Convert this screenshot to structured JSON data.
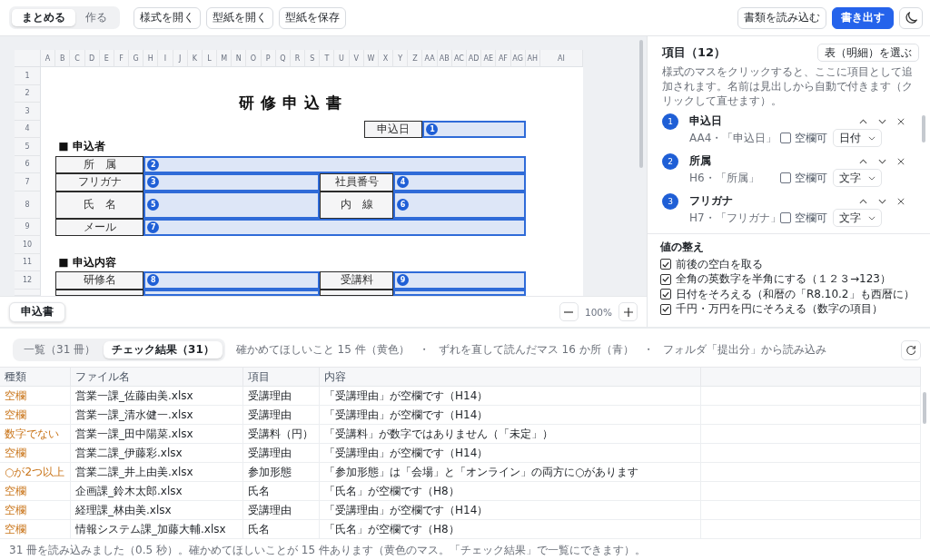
{
  "toolbar": {
    "modes": [
      {
        "label": "まとめる",
        "selected": true
      },
      {
        "label": "作る",
        "selected": false
      }
    ],
    "buttons": [
      "様式を開く",
      "型紙を開く",
      "型紙を保存"
    ],
    "actions": [
      {
        "label": "書類を読み込む",
        "kind": "secondary"
      },
      {
        "label": "書き出す",
        "kind": "primary"
      }
    ]
  },
  "sheet": {
    "columns": [
      "A",
      "B",
      "C",
      "D",
      "E",
      "F",
      "G",
      "H",
      "I",
      "J",
      "K",
      "L",
      "M",
      "N",
      "O",
      "P",
      "Q",
      "R",
      "S",
      "T",
      "U",
      "V",
      "W",
      "X",
      "Y",
      "Z",
      "AA",
      "AB",
      "AC",
      "AD",
      "AE",
      "AF",
      "AG",
      "AH",
      "AI"
    ],
    "rows": [
      "1",
      "2",
      "3",
      "4",
      "5",
      "6",
      "7",
      "8",
      "9",
      "10",
      "11",
      "12"
    ],
    "title": "研修申込書",
    "date": {
      "label": "申込日",
      "marker": "1"
    },
    "sections": [
      {
        "heading": "■ 申込者",
        "rows": [
          {
            "cells": [
              {
                "kind": "label",
                "text": "所　属"
              },
              {
                "kind": "field",
                "marker": "2"
              }
            ]
          },
          {
            "cells": [
              {
                "kind": "label",
                "text": "フリガナ"
              },
              {
                "kind": "field",
                "marker": "3"
              },
              {
                "kind": "label",
                "text": "社員番号"
              },
              {
                "kind": "field",
                "marker": "4"
              }
            ]
          },
          {
            "cells": [
              {
                "kind": "label",
                "text": "氏　名"
              },
              {
                "kind": "field",
                "marker": "5"
              },
              {
                "kind": "label",
                "text": "内　線"
              },
              {
                "kind": "field",
                "marker": "6"
              }
            ]
          },
          {
            "cells": [
              {
                "kind": "label",
                "text": "メール"
              },
              {
                "kind": "field",
                "marker": "7"
              }
            ]
          }
        ]
      },
      {
        "heading": "■ 申込内容",
        "rows": [
          {
            "cells": [
              {
                "kind": "label",
                "text": "研修名"
              },
              {
                "kind": "field",
                "marker": "8"
              },
              {
                "kind": "label",
                "text": "受講料"
              },
              {
                "kind": "field",
                "marker": "9"
              }
            ]
          },
          {
            "cells": [
              {
                "kind": "label"
              },
              {
                "kind": "field"
              },
              {
                "kind": "label"
              },
              {
                "kind": "field"
              }
            ]
          }
        ]
      }
    ]
  },
  "sheet_tabs": [
    {
      "label": "申込書",
      "selected": true
    }
  ],
  "zoom_level": "100%",
  "fields_panel": {
    "title": "項目（12）",
    "choose_button": "表（明細）を選ぶ",
    "hint": "様式のマスをクリックすると、ここに項目として追加されます。名前は見出しから自動で付きます（クリックして直せます）。",
    "items": [
      {
        "number": "1",
        "name": "申込日",
        "source": "AA4・「申込日」",
        "optional": false,
        "checkbox_label": "空欄可",
        "type": "日付"
      },
      {
        "number": "2",
        "name": "所属",
        "source": "H6・「所属」",
        "optional": false,
        "checkbox_label": "空欄可",
        "type": "文字"
      },
      {
        "number": "3",
        "name": "フリガナ",
        "source": "H7・「フリガナ」",
        "optional": false,
        "checkbox_label": "空欄可",
        "type": "文字"
      }
    ]
  },
  "normalize": {
    "title": "値の整え",
    "options": [
      {
        "label": "前後の空白を取る",
        "checked": true
      },
      {
        "label": "全角の英数字を半角にする（１２３→123）",
        "checked": true
      },
      {
        "label": "日付をそろえる（和暦の「R8.10.2」も西暦に）",
        "checked": true
      },
      {
        "label": "千円・万円を円にそろえる（数字の項目）",
        "checked": true
      }
    ]
  },
  "results": {
    "tabs": [
      {
        "label": "一覧（31 冊）",
        "selected": false
      },
      {
        "label": "チェック結果（31）",
        "selected": true
      }
    ],
    "notes": [
      "確かめてほしいこと 15 件（黄色）",
      "・",
      "ずれを直して読んだマス 16 か所（青）",
      "・",
      "フォルダ「提出分」から読み込み"
    ]
  },
  "table": {
    "columns": [
      "種類",
      "ファイル名",
      "項目",
      "内容"
    ],
    "rows": [
      {
        "type": "空欄",
        "file": "営業一課_佐藤由美.xlsx",
        "item": "受講理由",
        "detail": "「受講理由」が空欄です（H14）"
      },
      {
        "type": "空欄",
        "file": "営業一課_清水健一.xlsx",
        "item": "受講理由",
        "detail": "「受講理由」が空欄です（H14）"
      },
      {
        "type": "数字でない",
        "file": "営業一課_田中陽菜.xlsx",
        "item": "受講料（円）",
        "detail": "「受講料」が数字ではありません（「未定」）"
      },
      {
        "type": "空欄",
        "file": "営業二課_伊藤彩.xlsx",
        "item": "受講理由",
        "detail": "「受講理由」が空欄です（H14）"
      },
      {
        "type": "○が2つ以上",
        "file": "営業二課_井上由美.xlsx",
        "item": "参加形態",
        "detail": "「参加形態」は「会場」と「オンライン」の両方に○があります"
      },
      {
        "type": "空欄",
        "file": "企画課_鈴木太郎.xlsx",
        "item": "氏名",
        "detail": "「氏名」が空欄です（H8）"
      },
      {
        "type": "空欄",
        "file": "経理課_林由美.xlsx",
        "item": "受講理由",
        "detail": "「受講理由」が空欄です（H14）"
      },
      {
        "type": "空欄",
        "file": "情報システム課_加藤大輔.xlsx",
        "item": "氏名",
        "detail": "「氏名」が空欄です（H8）"
      }
    ]
  },
  "status_bar": "31 冊を読み込みました（0.5 秒）。確かめてほしいことが 15 件あります（黄色のマス。「チェック結果」で一覧にできます）。"
}
